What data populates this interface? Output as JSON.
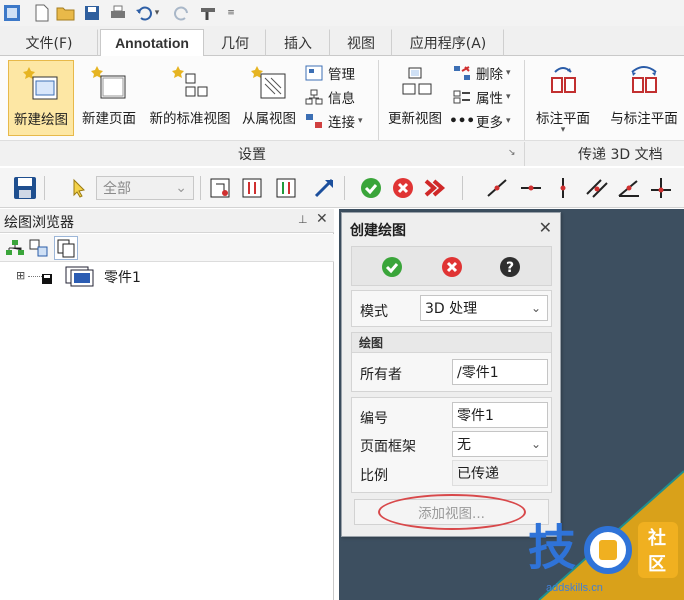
{
  "ribbon_tabs": {
    "file": "文件(F)",
    "annotation": "Annotation",
    "geometry": "几何",
    "insert": "插入",
    "view": "视图",
    "app": "应用程序(A)"
  },
  "ribbon": {
    "new_drawing": "新建绘图",
    "new_page": "新建页面",
    "new_std_view": "新的标准视图",
    "dependent_view": "从属视图",
    "manage": "管理",
    "info": "信息",
    "connect": "连接",
    "update_view": "更新视图",
    "delete": "删除",
    "properties": "属性",
    "more": "更多",
    "annotation_plane": "标注平面",
    "with_annotation_plane": "与标注平面",
    "group_settings": "设置",
    "group_pass_3d": "传递 3D 文档"
  },
  "cmdbar": {
    "filter_value": "全部"
  },
  "browser": {
    "title": "绘图浏览器",
    "tree_item": "零件1"
  },
  "dialog": {
    "title": "创建绘图",
    "mode_label": "模式",
    "mode_value": "3D 处理",
    "drawing_section": "绘图",
    "owner_label": "所有者",
    "owner_value": "/零件1",
    "number_label": "编号",
    "number_value": "零件1",
    "frame_label": "页面框架",
    "frame_value": "无",
    "scale_label": "比例",
    "scale_value": "已传递",
    "add_view_button": "添加视图..."
  },
  "watermark": {
    "char1": "技",
    "char2": "社",
    "char3": "区",
    "url": "addskills.cn"
  },
  "colors": {
    "accept": "#3aa53a",
    "cancel": "#e03434",
    "highlight": "#d8484a",
    "viewport": "#3d4f60",
    "part_yellow": "#d9a11a"
  }
}
